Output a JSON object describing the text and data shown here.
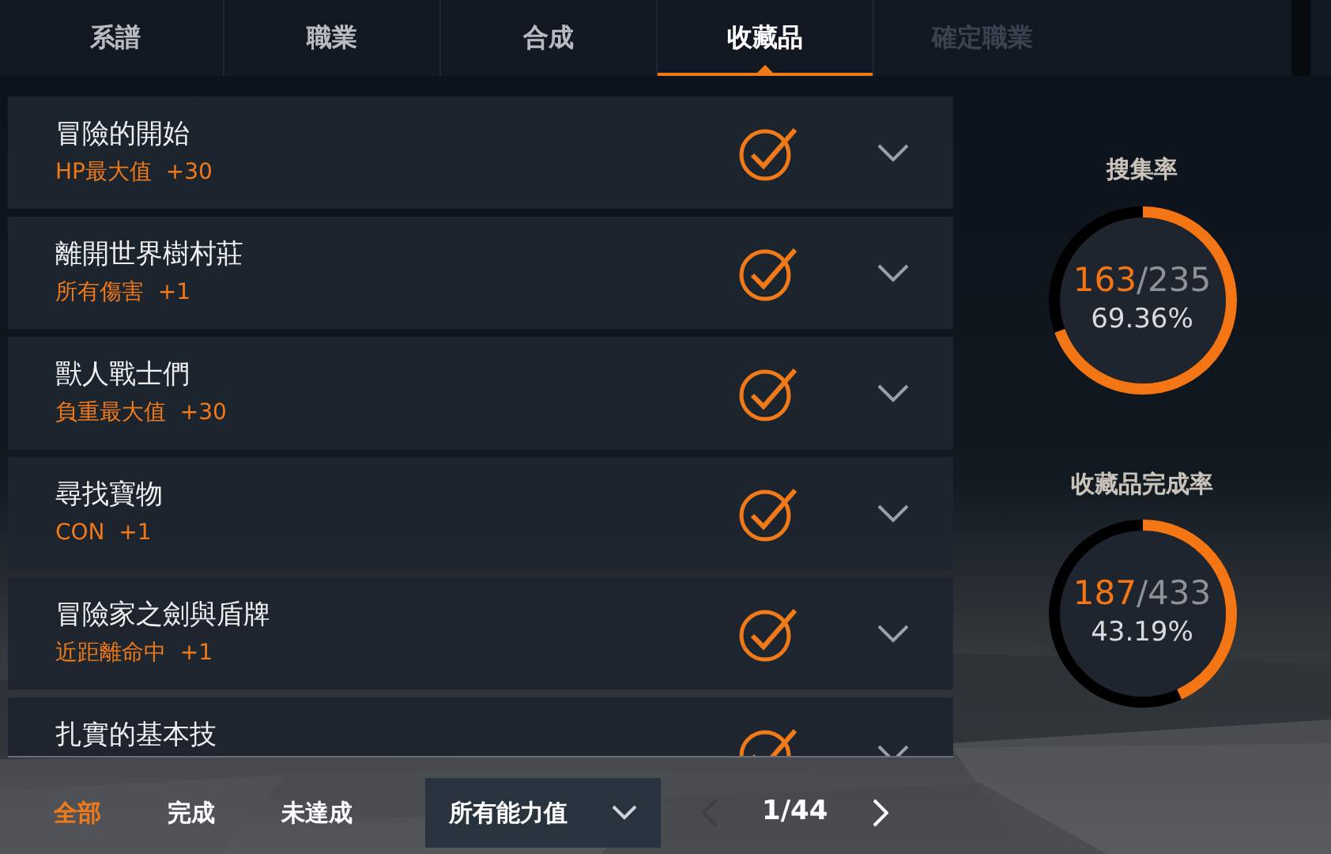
{
  "tabs": [
    {
      "label": "系譜",
      "selected": false,
      "disabled": false
    },
    {
      "label": "職業",
      "selected": false,
      "disabled": false
    },
    {
      "label": "合成",
      "selected": false,
      "disabled": false
    },
    {
      "label": "收藏品",
      "selected": true,
      "disabled": false
    },
    {
      "label": "確定職業",
      "selected": false,
      "disabled": true
    }
  ],
  "collections": [
    {
      "title": "冒險的開始",
      "reward": "HP最大值  +30",
      "completed": true
    },
    {
      "title": "離開世界樹村莊",
      "reward": "所有傷害  +1",
      "completed": true
    },
    {
      "title": "獸人戰士們",
      "reward": "負重最大值  +30",
      "completed": true
    },
    {
      "title": "尋找寶物",
      "reward": "CON  +1",
      "completed": true
    },
    {
      "title": "冒險家之劍與盾牌",
      "reward": "近距離命中  +1",
      "completed": true
    },
    {
      "title": "扎實的基本技",
      "completed": true
    }
  ],
  "stats": [
    {
      "title": "搜集率",
      "count": "163",
      "total": "/235",
      "percent": "69.36%",
      "level": 0.6936
    },
    {
      "title": "收藏品完成率",
      "count": "187",
      "total": "/433",
      "percent": "43.19%",
      "level": 0.4319
    }
  ],
  "filters": [
    {
      "label": "全部",
      "selected": true
    },
    {
      "label": "完成",
      "selected": false
    },
    {
      "label": "未達成",
      "selected": false
    }
  ],
  "stat_dropdown": {
    "value": "所有能力值"
  },
  "pager": {
    "page": "1/44",
    "prev_disabled": true,
    "next_disabled": false
  }
}
